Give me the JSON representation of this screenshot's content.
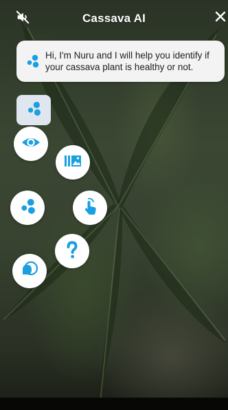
{
  "header": {
    "title": "Cassava AI",
    "mute_icon": "volume-mute-icon",
    "close_icon": "close-icon"
  },
  "assistant": {
    "message": "Hi, I'm Nuru and I will help you identify if your cassava plant is healthy or not.",
    "logo_icon": "nuru-logo-icon"
  },
  "actions": [
    {
      "name": "view",
      "icon": "eye-icon"
    },
    {
      "name": "gallery",
      "icon": "gallery-icon"
    },
    {
      "name": "nuru",
      "icon": "nuru-logo-icon"
    },
    {
      "name": "tap",
      "icon": "tap-hand-icon"
    },
    {
      "name": "help",
      "icon": "question-mark-icon"
    },
    {
      "name": "chat",
      "icon": "chat-bubble-icon"
    }
  ],
  "colors": {
    "accent": "#1aa0e0",
    "bubble_bg": "#f3f3f3",
    "nuru_tab_bg": "#dfe6ef",
    "button_bg": "#ffffff"
  }
}
